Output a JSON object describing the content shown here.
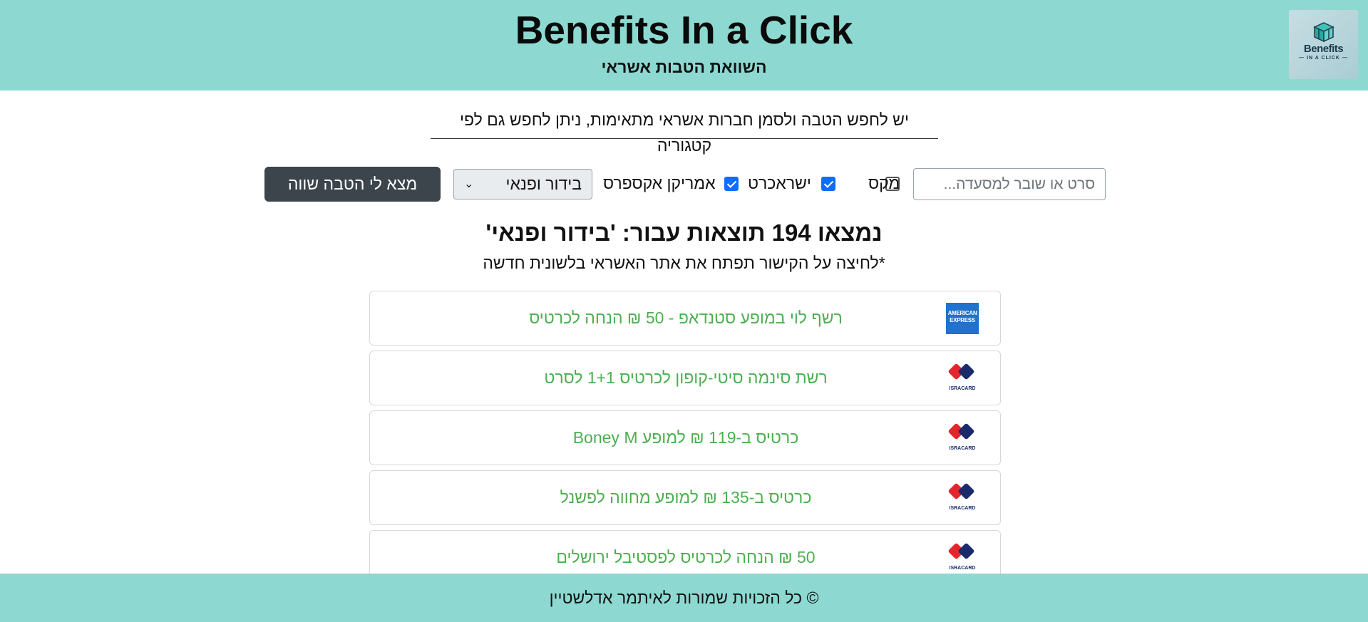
{
  "header": {
    "title": "Benefits In a Click",
    "subtitle": "השוואת הטבות אשראי",
    "logo_text": "Benefits",
    "logo_subtext": "— IN A CLICK —"
  },
  "instruction": "יש לחפש הטבה ולסמן חברות אשראי מתאימות, ניתן לחפש גם לפי קטגוריה",
  "controls": {
    "search_placeholder": "סרט או שובר למסעדה...",
    "checkboxes": [
      {
        "label": "מקס",
        "checked": false
      },
      {
        "label": "ישראכרט",
        "checked": true
      },
      {
        "label": "אמריקן אקספרס",
        "checked": true
      }
    ],
    "category_selected": "בידור ופנאי",
    "find_button": "מצא לי הטבה שווה"
  },
  "results": {
    "title": "נמצאו 194 תוצאות עבור: 'בידור ופנאי'",
    "note": "*לחיצה על הקישור תפתח את אתר האשראי בלשונית חדשה",
    "items": [
      {
        "text": "רשף לוי במופע סטנדאפ - 50 ₪ הנחה לכרטיס",
        "card": "amex",
        "card_text": "AMERICAN EXPRESS"
      },
      {
        "text": "רשת סינמה סיטי-קופון לכרטיס 1+1 לסרט",
        "card": "isracard",
        "card_text": "ISRACARD"
      },
      {
        "text": "כרטיס ב-119 ₪ למופע Boney M",
        "card": "isracard",
        "card_text": "ISRACARD"
      },
      {
        "text": "כרטיס ב-135 ₪ למופע מחווה לפשנל",
        "card": "isracard",
        "card_text": "ISRACARD"
      },
      {
        "text": "50 ₪ הנחה לכרטיס לפסטיבל ירושלים",
        "card": "isracard",
        "card_text": "ISRACARD"
      }
    ]
  },
  "footer": "© כל הזכויות שמורות לאיתמר אדלשטיין",
  "colors": {
    "header_bg": "#8dd9d2",
    "link_green": "#4caf50",
    "button_dark": "#3c444c",
    "checkbox_blue": "#0d6efd"
  }
}
